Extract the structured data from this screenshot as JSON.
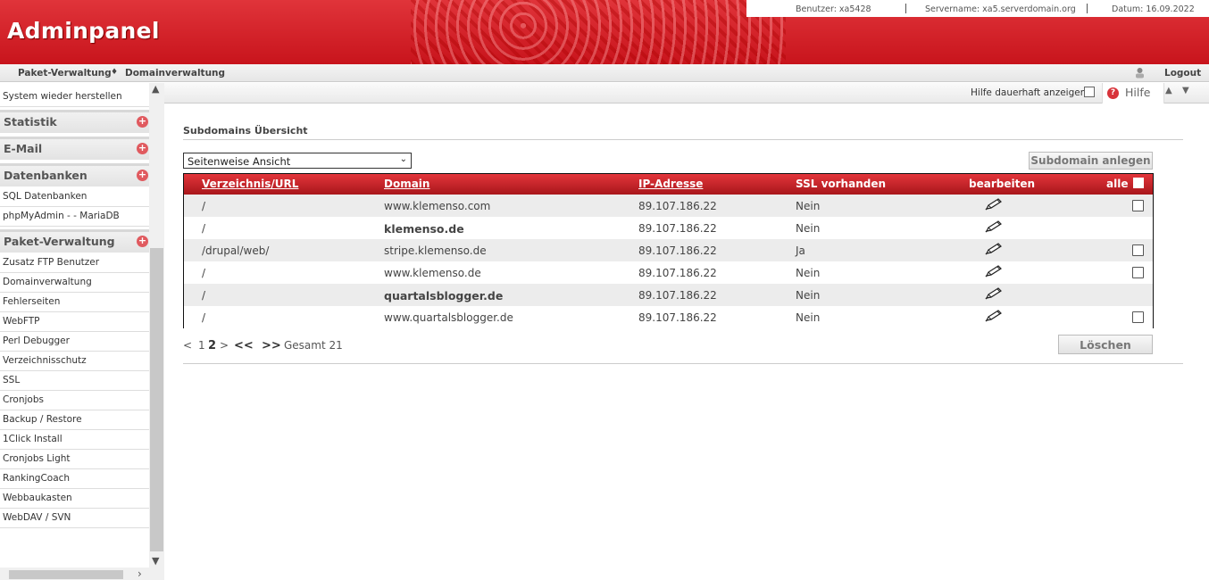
{
  "header": {
    "logo": "Adminpanel",
    "user": "Benutzer: xa5428",
    "server": "Servername: xa5.serverdomain.org",
    "date": "Datum: 16.09.2022"
  },
  "navbar": {
    "crumbs": [
      "Paket-Verwaltung",
      "Domainverwaltung"
    ],
    "separator": "♦",
    "logout": "Logout"
  },
  "sidebar": {
    "partial_top": "phpMyAdmin",
    "items": [
      {
        "type": "item",
        "label": "System wieder herstellen"
      },
      {
        "type": "head",
        "label": "Statistik"
      },
      {
        "type": "head",
        "label": "E-Mail"
      },
      {
        "type": "head",
        "label": "Datenbanken"
      },
      {
        "type": "item",
        "label": "SQL Datenbanken"
      },
      {
        "type": "item",
        "label": "phpMyAdmin - - MariaDB"
      },
      {
        "type": "head",
        "label": "Paket-Verwaltung"
      },
      {
        "type": "item",
        "label": "Zusatz FTP Benutzer"
      },
      {
        "type": "item",
        "label": "Domainverwaltung"
      },
      {
        "type": "item",
        "label": "Fehlerseiten"
      },
      {
        "type": "item",
        "label": "WebFTP"
      },
      {
        "type": "item",
        "label": "Perl Debugger"
      },
      {
        "type": "item",
        "label": "Verzeichnisschutz"
      },
      {
        "type": "item",
        "label": "SSL"
      },
      {
        "type": "item",
        "label": "Cronjobs"
      },
      {
        "type": "item",
        "label": "Backup / Restore"
      },
      {
        "type": "item",
        "label": "1Click Install"
      },
      {
        "type": "item",
        "label": "Cronjobs Light"
      },
      {
        "type": "item",
        "label": "RankingCoach"
      },
      {
        "type": "item",
        "label": "Webbaukasten"
      },
      {
        "type": "item",
        "label": "WebDAV / SVN"
      }
    ]
  },
  "helpbar": {
    "permanent_label": "Hilfe dauerhaft anzeigen",
    "help_label": "Hilfe"
  },
  "main": {
    "title": "Subdomains Übersicht",
    "view_select": "Seitenweise Ansicht",
    "create_button": "Subdomain anlegen",
    "columns": [
      "Verzeichnis/URL",
      "Domain",
      "IP-Adresse",
      "SSL vorhanden",
      "bearbeiten",
      "alle"
    ],
    "rows": [
      {
        "dir": "/",
        "domain": "www.klemenso.com",
        "ip": "89.107.186.22",
        "ssl": "Nein",
        "bold": false,
        "checkbox": true
      },
      {
        "dir": "/",
        "domain": "klemenso.de",
        "ip": "89.107.186.22",
        "ssl": "Nein",
        "bold": true,
        "checkbox": false
      },
      {
        "dir": "/drupal/web/",
        "domain": "stripe.klemenso.de",
        "ip": "89.107.186.22",
        "ssl": "Ja",
        "bold": false,
        "checkbox": true
      },
      {
        "dir": "/",
        "domain": "www.klemenso.de",
        "ip": "89.107.186.22",
        "ssl": "Nein",
        "bold": false,
        "checkbox": true
      },
      {
        "dir": "/",
        "domain": "quartalsblogger.de",
        "ip": "89.107.186.22",
        "ssl": "Nein",
        "bold": true,
        "checkbox": false
      },
      {
        "dir": "/",
        "domain": "www.quartalsblogger.de",
        "ip": "89.107.186.22",
        "ssl": "Nein",
        "bold": false,
        "checkbox": true
      }
    ],
    "pager": {
      "prev": "<",
      "page1": "1",
      "page2": "2",
      "next": ">",
      "first": "<<",
      "last": ">>",
      "total": "Gesamt 21"
    },
    "delete_button": "Löschen"
  }
}
